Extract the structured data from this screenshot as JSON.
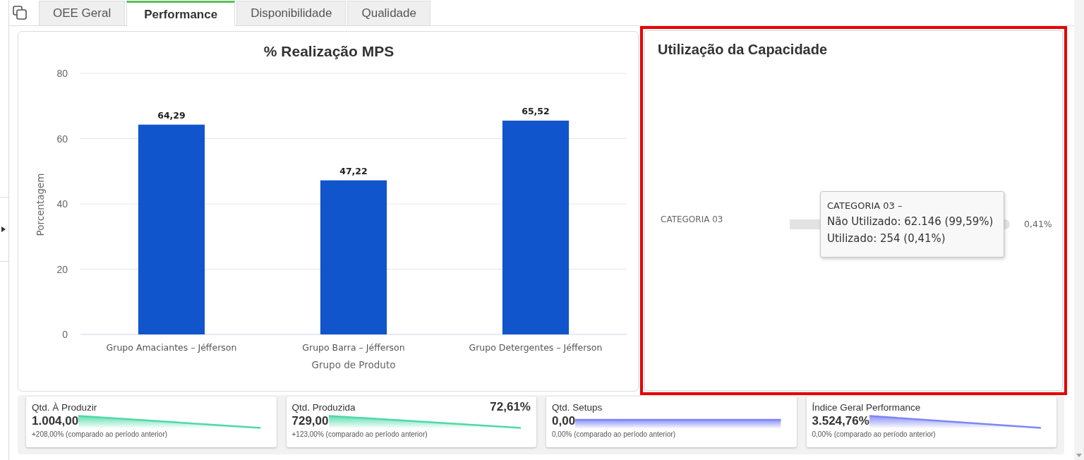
{
  "tabs": [
    {
      "label": "OEE Geral",
      "selected": false
    },
    {
      "label": "Performance",
      "selected": true
    },
    {
      "label": "Disponibilidade",
      "selected": false
    },
    {
      "label": "Qualidade",
      "selected": false
    }
  ],
  "mps_panel": {
    "chart_data": {
      "type": "bar",
      "title": "% Realização MPS",
      "xlabel": "Grupo de Produto",
      "ylabel": "Porcentagem",
      "categories": [
        "Grupo Amaciantes – Jéfferson",
        "Grupo Barra – Jéfferson",
        "Grupo Detergentes – Jéfferson"
      ],
      "series": [
        {
          "color": "#1155cc",
          "values": [
            64.29,
            47.22,
            65.52
          ]
        }
      ],
      "ylim": [
        0,
        80
      ],
      "yticks": [
        0,
        20,
        40,
        60,
        80
      ],
      "grid": true,
      "value_labels": [
        "64,29",
        "47,22",
        "65,52"
      ]
    }
  },
  "capacity_panel": {
    "highlighted": true,
    "title": "Utilização da Capacidade",
    "rows": [
      {
        "label": "CATEGORIA 03",
        "value_label": "0,41%"
      }
    ],
    "tooltip": {
      "title": "CATEGORIA 03 –",
      "lines": [
        "Não Utilizado: 62.146 (99,59%)",
        "Utilizado: 254 (0,41%)"
      ]
    }
  },
  "kpi_cards": [
    {
      "label": "Qtd. À Produzir",
      "value": "1.004,00",
      "change": "+208,00% (comparado ao período anterior)",
      "kind": "falling",
      "color": "#4fd9a6"
    },
    {
      "label": "Qtd. Produzida",
      "percent": "72,61%",
      "value": "729,00",
      "change": "+123,00% (comparado ao período anterior)",
      "kind": "falling",
      "color": "#4fd9a6"
    },
    {
      "label": "Qtd. Setups",
      "value": "0,00",
      "change": "0,00% (comparado ao período anterior)",
      "kind": "flat",
      "color": "#7f86f4"
    },
    {
      "label": "Índice Geral Performance",
      "value": "3.524,76%",
      "change": "0,00% (comparado ao período anterior)",
      "kind": "falling",
      "color": "#7f86f4"
    }
  ]
}
